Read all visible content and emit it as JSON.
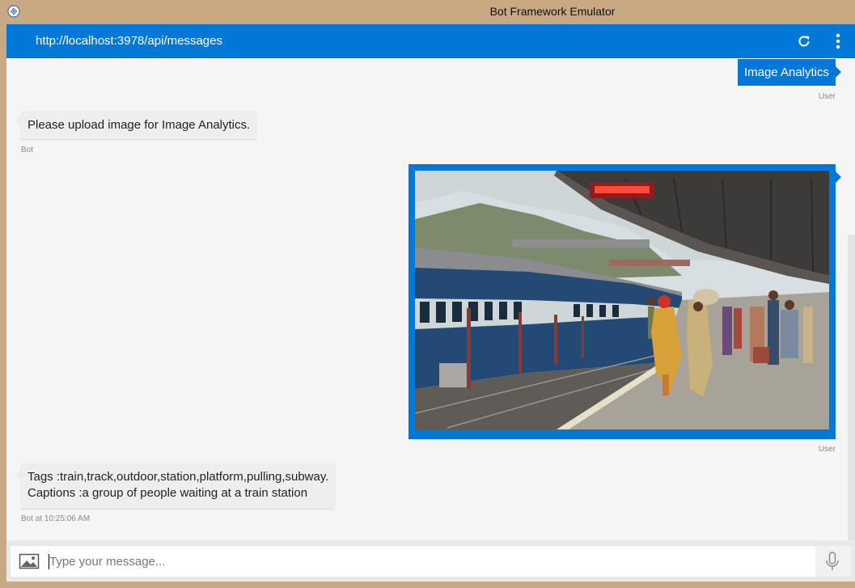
{
  "window": {
    "title": "Bot Framework Emulator"
  },
  "address_bar": {
    "url": "http://localhost:3978/api/messages",
    "icons": [
      "refresh-icon",
      "more-vertical-icon"
    ]
  },
  "messages": [
    {
      "from": "user",
      "type": "text",
      "text": "Image Analytics",
      "meta": "User"
    },
    {
      "from": "bot",
      "type": "text",
      "text": "Please upload image for Image Analytics.",
      "meta": "Bot"
    },
    {
      "from": "user",
      "type": "image",
      "image_icon": "train-station-photo",
      "meta": "User"
    },
    {
      "from": "bot",
      "type": "text",
      "lines": [
        "Tags :train,track,outdoor,station,platform,pulling,subway.",
        "Captions :a group of people waiting at a train station"
      ],
      "meta": "Bot at 10:25:06 AM"
    }
  ],
  "input": {
    "placeholder": "Type your message...",
    "value": "",
    "icons": [
      "image-upload-icon",
      "microphone-icon"
    ]
  },
  "colors": {
    "accent": "#0078d7",
    "window_frame": "#c9a982",
    "chat_background": "#f5f5f6",
    "bot_bubble": "#eceef0"
  }
}
